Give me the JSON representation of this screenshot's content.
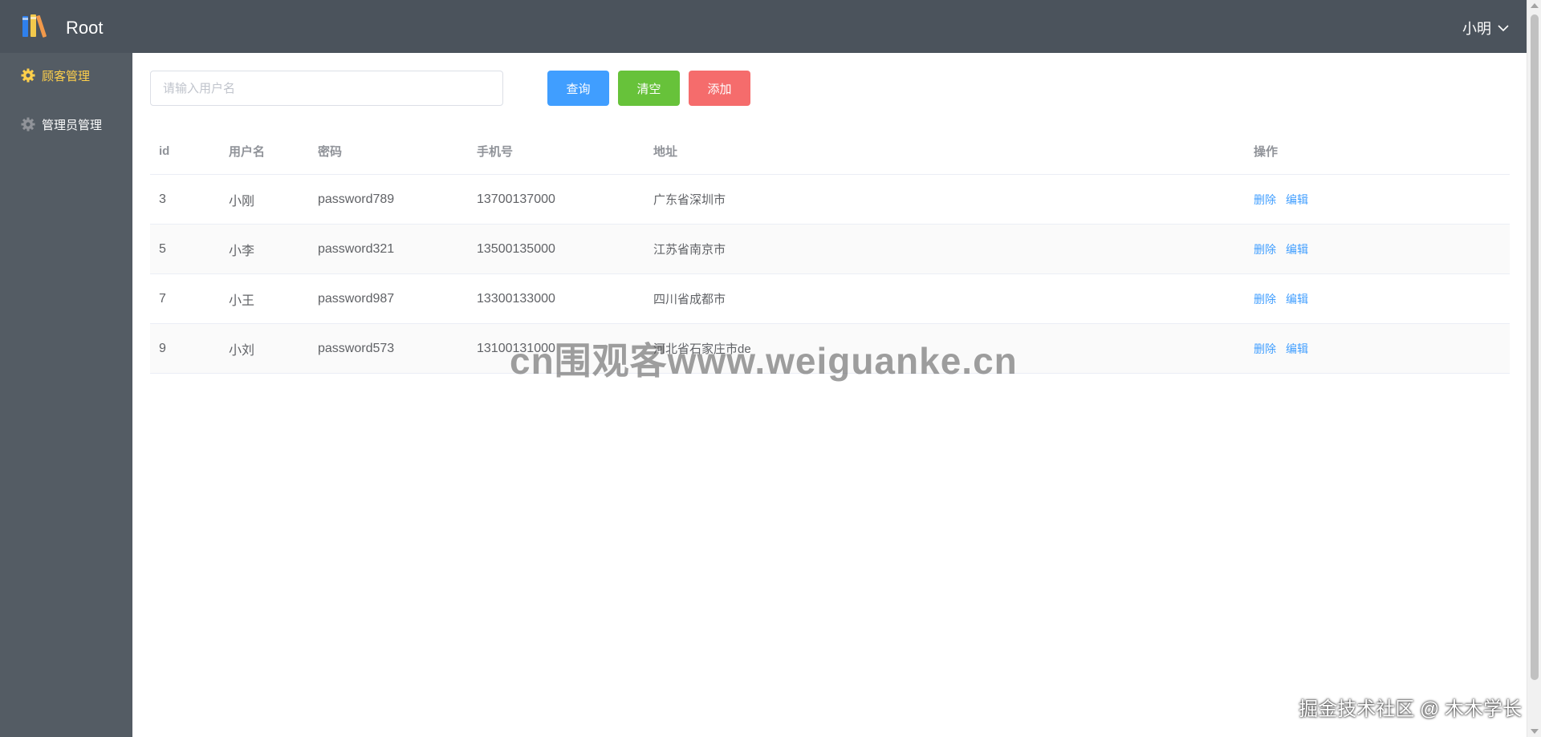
{
  "header": {
    "title": "Root",
    "user_name": "小明"
  },
  "sidebar": {
    "items": [
      {
        "label": "顾客管理",
        "icon": "gear-icon",
        "active": true
      },
      {
        "label": "管理员管理",
        "icon": "gear-icon",
        "active": false
      }
    ]
  },
  "search": {
    "placeholder": "请输入用户名",
    "value": ""
  },
  "toolbar": {
    "query_label": "查询",
    "clear_label": "清空",
    "add_label": "添加"
  },
  "table": {
    "columns": [
      "id",
      "用户名",
      "密码",
      "手机号",
      "地址",
      "操作"
    ],
    "rows": [
      {
        "id": "3",
        "username": "小刚",
        "password": "password789",
        "phone": "13700137000",
        "address": "广东省深圳市"
      },
      {
        "id": "5",
        "username": "小李",
        "password": "password321",
        "phone": "13500135000",
        "address": "江苏省南京市"
      },
      {
        "id": "7",
        "username": "小王",
        "password": "password987",
        "phone": "13300133000",
        "address": "四川省成都市"
      },
      {
        "id": "9",
        "username": "小刘",
        "password": "password573",
        "phone": "13100131000",
        "address": "河北省石家庄市de"
      }
    ],
    "delete_label": "删除",
    "edit_label": "编辑"
  },
  "overlay": {
    "watermark": "cn围观客www.weiguanke.cn",
    "credit": "掘金技术社区 @ 木木学长"
  },
  "colors": {
    "header_bg": "#4b535c",
    "sidebar_bg": "#545c64",
    "active_menu": "#ffd04b",
    "primary": "#409eff",
    "success": "#67c23a",
    "danger": "#f56c6c"
  }
}
